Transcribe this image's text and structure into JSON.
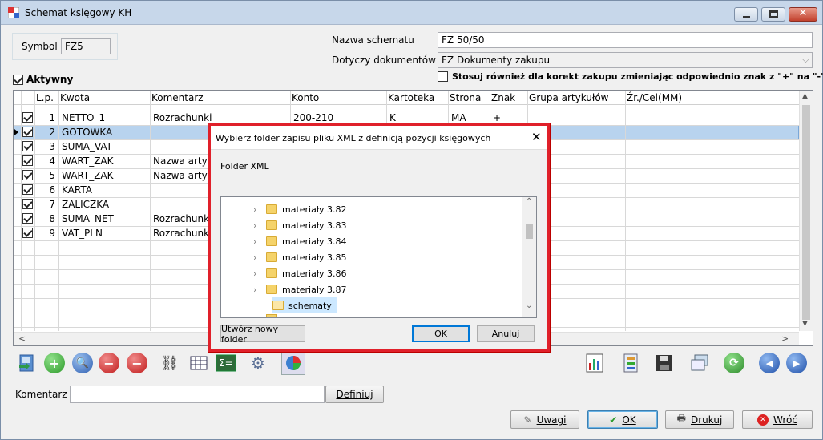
{
  "window": {
    "title": "Schemat księgowy KH"
  },
  "form": {
    "symbol_label": "Symbol",
    "symbol_value": "FZ5",
    "nazwa_label": "Nazwa schematu",
    "nazwa_value": "FZ 50/50",
    "dotyczy_label": "Dotyczy dokumentów",
    "dotyczy_value": "FZ Dokumenty zakupu",
    "aktywny_label": "Aktywny",
    "stosuj_label": "Stosuj również dla korekt zakupu zmieniając odpowiednio znak z \"+\" na \"-\""
  },
  "grid": {
    "columns": [
      "L.p.",
      "Kwota",
      "Komentarz",
      "Konto",
      "Kartoteka",
      "Strona",
      "Znak",
      "Grupa artykułów",
      "Źr./Cel(MM)"
    ],
    "rows": [
      {
        "lp": "1",
        "kwota": "NETTO_1",
        "komentarz": "Rozrachunki",
        "konto": "200-210",
        "kartoteka": "K",
        "strona": "MA",
        "znak": "+"
      },
      {
        "lp": "2",
        "kwota": "GOTOWKA",
        "komentarz": "",
        "konto": "",
        "kartoteka": "",
        "strona": "",
        "znak": ""
      },
      {
        "lp": "3",
        "kwota": "SUMA_VAT",
        "komentarz": "",
        "konto": "",
        "kartoteka": "",
        "strona": "",
        "znak": ""
      },
      {
        "lp": "4",
        "kwota": "WART_ZAK",
        "komentarz": "Nazwa artyk",
        "konto": "",
        "kartoteka": "",
        "strona": "",
        "znak": ""
      },
      {
        "lp": "5",
        "kwota": "WART_ZAK",
        "komentarz": "Nazwa artyk",
        "konto": "",
        "kartoteka": "",
        "strona": "",
        "znak": ""
      },
      {
        "lp": "6",
        "kwota": "KARTA",
        "komentarz": "",
        "konto": "",
        "kartoteka": "",
        "strona": "",
        "znak": ""
      },
      {
        "lp": "7",
        "kwota": "ZALICZKA",
        "komentarz": "",
        "konto": "",
        "kartoteka": "",
        "strona": "",
        "znak": ""
      },
      {
        "lp": "8",
        "kwota": "SUMA_NET",
        "komentarz": "Rozrachunk",
        "konto": "",
        "kartoteka": "",
        "strona": "",
        "znak": ""
      },
      {
        "lp": "9",
        "kwota": "VAT_PLN",
        "komentarz": "Rozrachunk",
        "konto": "",
        "kartoteka": "",
        "strona": "",
        "znak": ""
      }
    ]
  },
  "bottom": {
    "komentarz_label": "Komentarz",
    "komentarz_value": "",
    "definiuj": "Definiuj",
    "uwagi": "Uwagi",
    "ok": "OK",
    "drukuj": "Drukuj",
    "wroc": "Wróć"
  },
  "dialog": {
    "title": "Wybierz folder zapisu pliku XML z definicją pozycji księgowych",
    "folder_label": "Folder XML",
    "folders": [
      "materiały 3.82",
      "materiały 3.83",
      "materiały 3.84",
      "materiały 3.85",
      "materiały 3.86",
      "materiały 3.87"
    ],
    "selected": "schematy",
    "new_folder": "Utwórz nowy folder",
    "ok": "OK",
    "cancel": "Anuluj"
  }
}
